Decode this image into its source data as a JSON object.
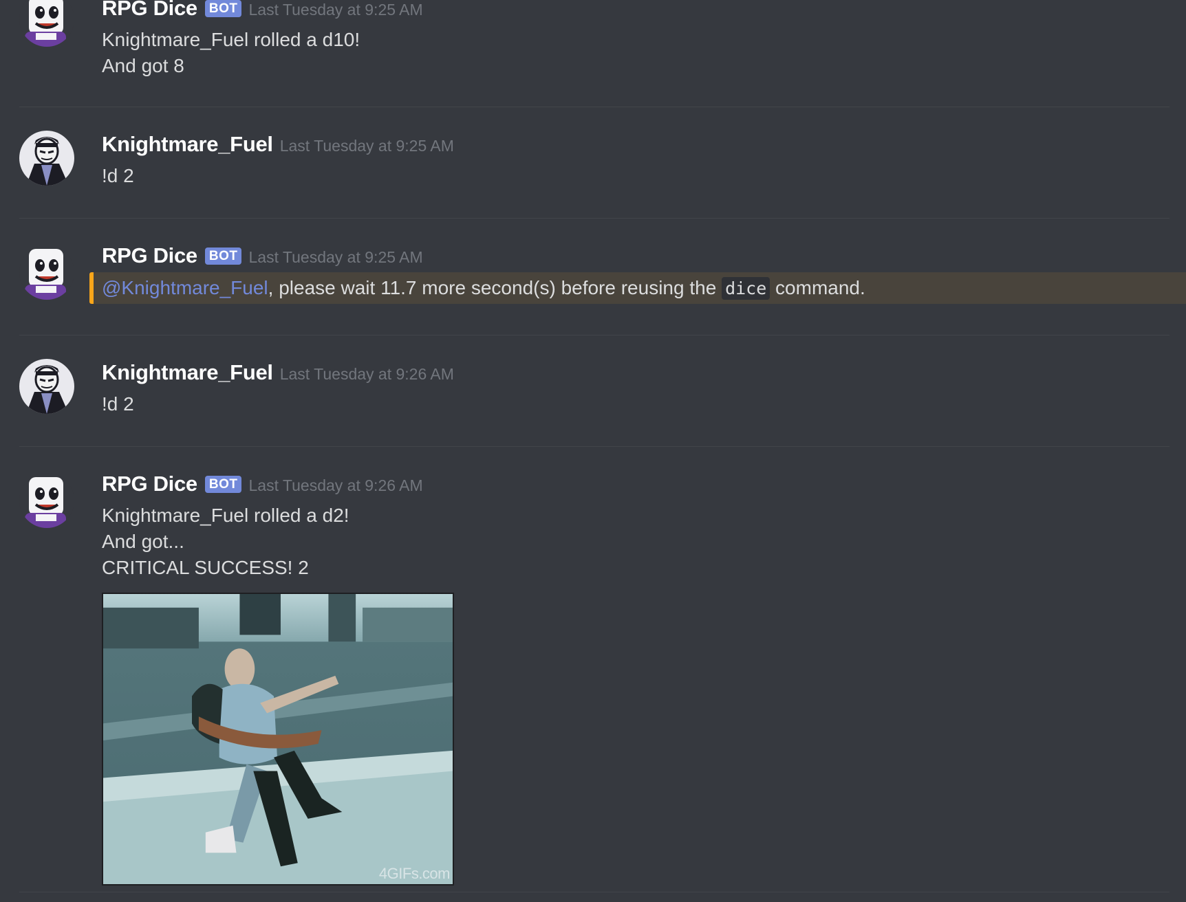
{
  "messages": [
    {
      "author": "RPG Dice",
      "bot_tag": "BOT",
      "timestamp": "Last Tuesday at 9:25 AM",
      "lines": [
        "Knightmare_Fuel rolled a d10!",
        "And got 8"
      ]
    },
    {
      "author": "Knightmare_Fuel",
      "timestamp": "Last Tuesday at 9:25 AM",
      "lines": [
        "!d 2"
      ]
    },
    {
      "author": "RPG Dice",
      "bot_tag": "BOT",
      "timestamp": "Last Tuesday at 9:25 AM",
      "mention": "@Knightmare_Fuel",
      "text_before_code": ", please wait 11.7 more second(s) before reusing the ",
      "code": "dice",
      "text_after_code": " command."
    },
    {
      "author": "Knightmare_Fuel",
      "timestamp": "Last Tuesday at 9:26 AM",
      "lines": [
        "!d 2"
      ]
    },
    {
      "author": "RPG Dice",
      "bot_tag": "BOT",
      "timestamp": "Last Tuesday at 9:26 AM",
      "lines": [
        "Knightmare_Fuel rolled a d2!",
        "And got...",
        "CRITICAL SUCCESS! 2"
      ],
      "gif_watermark": "4GIFs.com"
    }
  ],
  "colors": {
    "background": "#36393f",
    "bot_tag": "#7289da",
    "mention": "#7289da",
    "highlight_bar": "#faa61a",
    "highlight_bg": "#49443c",
    "timestamp": "#72767d"
  },
  "icons": {
    "bot_avatar": "cuphead-mugman-avatar-icon",
    "user_avatar": "knight-character-avatar-icon"
  }
}
